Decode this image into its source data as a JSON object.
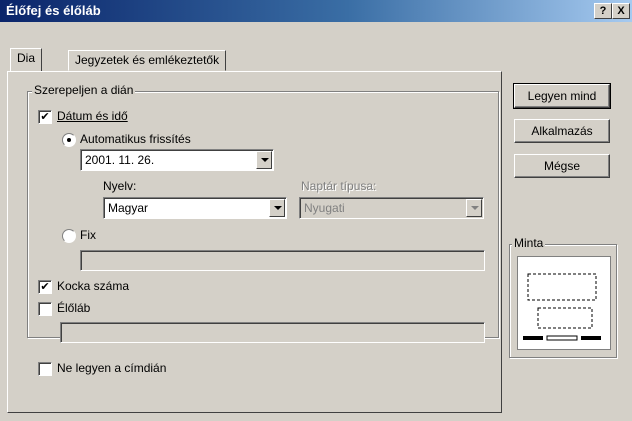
{
  "window": {
    "title": "Élőfej és élőláb",
    "help_btn": "?",
    "close_btn": "X"
  },
  "tabs": [
    {
      "label": "Dia"
    },
    {
      "label": "Jegyzetek és emlékeztetők"
    }
  ],
  "group_include": {
    "label": "Szerepeljen a dián"
  },
  "date_time": {
    "label": "Dátum és idő",
    "checked": true
  },
  "auto_update": {
    "label": "Automatikus frissítés",
    "selected": true,
    "value": "2001. 11. 26."
  },
  "language": {
    "label": "Nyelv:",
    "value": "Magyar"
  },
  "calendar": {
    "label": "Naptár típusa:",
    "value": "Nyugati"
  },
  "fixed": {
    "label": "Fix",
    "selected": false,
    "value": ""
  },
  "slide_number": {
    "label": "Kocka száma",
    "checked": true
  },
  "footer": {
    "label": "Élőláb",
    "checked": false,
    "value": ""
  },
  "no_title_slide": {
    "label": "Ne legyen a címdián",
    "checked": false
  },
  "buttons": {
    "apply_all": "Legyen mind",
    "apply": "Alkalmazás",
    "cancel": "Mégse"
  },
  "preview": {
    "label": "Minta"
  },
  "check_glyph": "✔"
}
